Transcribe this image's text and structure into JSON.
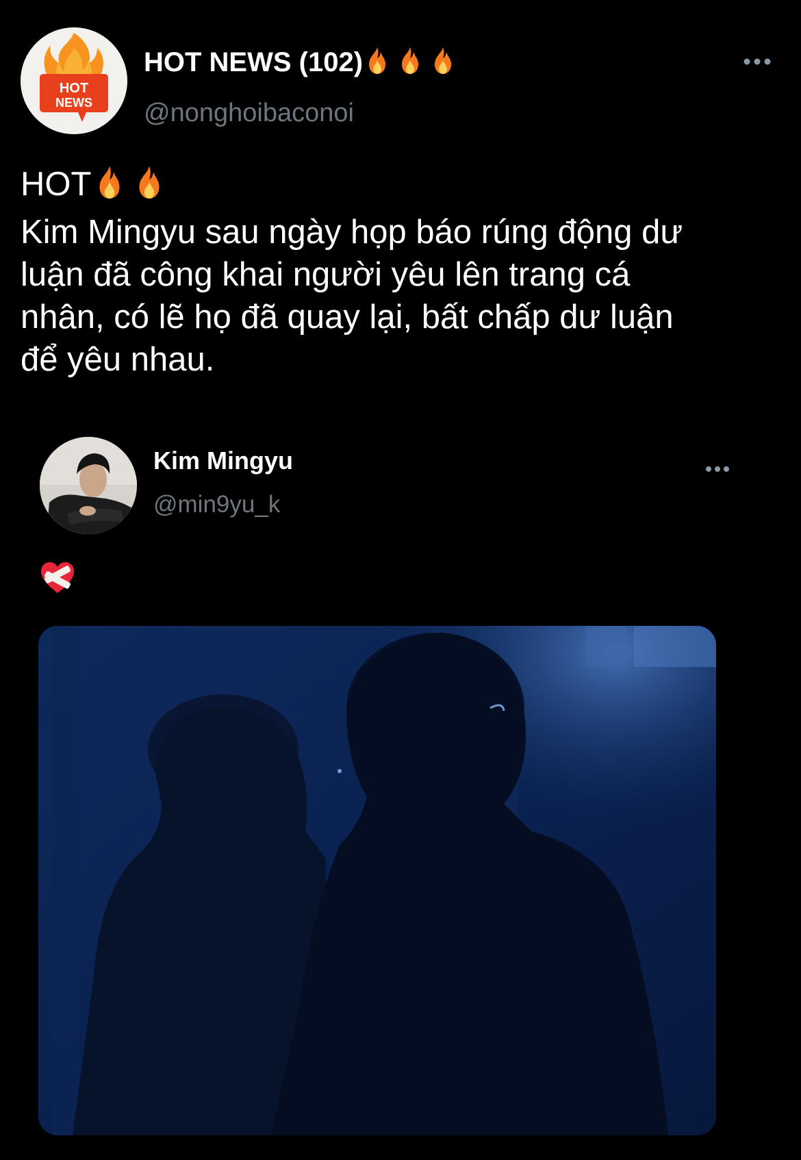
{
  "tweet": {
    "author_name": "HOT NEWS (102)",
    "author_handle": "@nonghoibaconoi",
    "avatar_logo_line1": "HOT",
    "avatar_logo_line2": "NEWS",
    "text_line0": "HOT",
    "text_lines": [
      "Kim Mingyu sau ngày họp báo rúng động dư",
      "luận đã công khai người yêu lên trang cá",
      "nhân, có lẽ họ đã quay lại, bất chấp dư luận",
      "để yêu nhau."
    ],
    "more_icon": "more-horizontal-icon",
    "fire_icon": "fire-emoji"
  },
  "quoted_tweet": {
    "author_name": "Kim Mingyu",
    "author_handle": "@min9yu_k",
    "body_icon": "mending-heart-emoji",
    "more_icon": "more-horizontal-icon",
    "photo_description_icon": "photo-image"
  },
  "colors": {
    "background": "#000000",
    "text_primary": "#ffffff",
    "text_secondary": "#6e767d",
    "fire_orange": "#f7791e",
    "photo_blue": "#0b2350"
  }
}
